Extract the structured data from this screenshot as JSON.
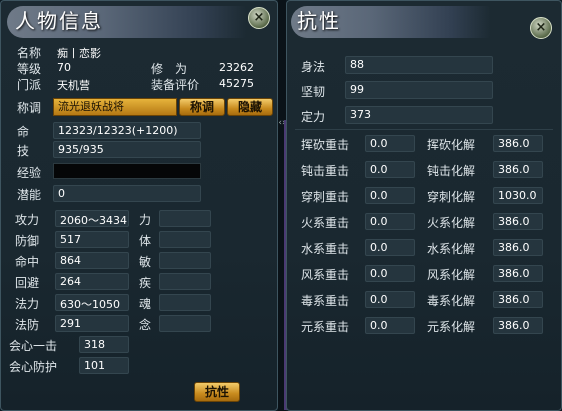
{
  "left": {
    "title": "人物信息",
    "close_icon": "×",
    "info": [
      {
        "label": "名称",
        "value": "痴丨恋影"
      },
      {
        "label": "等级",
        "value": "70"
      },
      {
        "label": "门派",
        "value": "天机营"
      },
      {
        "label": "修　为",
        "value": "23262"
      },
      {
        "label": "装备评价",
        "value": "45275"
      }
    ],
    "title_label": "称调",
    "title_value": "流光退妖战将",
    "title_button": "称调",
    "hide_button": "隐藏",
    "hp_label": "命",
    "hp_value": "12323/12323(+1200)",
    "mp_label": "技",
    "mp_value": "935/935",
    "exp_label": "经验",
    "potential_label": "潜能",
    "potential_value": "0",
    "stats_left": [
      {
        "label": "攻力",
        "value": "2060～3434"
      },
      {
        "label": "防御",
        "value": "517"
      },
      {
        "label": "命中",
        "value": "864"
      },
      {
        "label": "回避",
        "value": "264"
      },
      {
        "label": "法力",
        "value": "630～1050"
      },
      {
        "label": "法防",
        "value": "291"
      },
      {
        "label": "会心一击",
        "value": "318"
      },
      {
        "label": "会心防护",
        "value": "101"
      }
    ],
    "stats_right": [
      {
        "label": "力",
        "value": ""
      },
      {
        "label": "体",
        "value": ""
      },
      {
        "label": "敏",
        "value": ""
      },
      {
        "label": "疾",
        "value": ""
      },
      {
        "label": "魂",
        "value": ""
      },
      {
        "label": "念",
        "value": ""
      }
    ],
    "resist_button": "抗性"
  },
  "right": {
    "title": "抗性",
    "close_icon": "×",
    "top_stats": [
      {
        "label": "身法",
        "value": "88"
      },
      {
        "label": "坚韧",
        "value": "99"
      },
      {
        "label": "定力",
        "value": "373"
      }
    ],
    "resist_rows": [
      {
        "crit_label": "挥砍重击",
        "crit_value": "0.0",
        "res_label": "挥砍化解",
        "res_value": "386.0"
      },
      {
        "crit_label": "钝击重击",
        "crit_value": "0.0",
        "res_label": "钝击化解",
        "res_value": "386.0"
      },
      {
        "crit_label": "穿刺重击",
        "crit_value": "0.0",
        "res_label": "穿刺化解",
        "res_value": "1030.0"
      },
      {
        "crit_label": "火系重击",
        "crit_value": "0.0",
        "res_label": "火系化解",
        "res_value": "386.0"
      },
      {
        "crit_label": "水系重击",
        "crit_value": "0.0",
        "res_label": "水系化解",
        "res_value": "386.0"
      },
      {
        "crit_label": "风系重击",
        "crit_value": "0.0",
        "res_label": "风系化解",
        "res_value": "386.0"
      },
      {
        "crit_label": "毒系重击",
        "crit_value": "0.0",
        "res_label": "毒系化解",
        "res_value": "386.0"
      },
      {
        "crit_label": "元系重击",
        "crit_value": "0.0",
        "res_label": "元系化解",
        "res_value": "386.0"
      }
    ]
  }
}
